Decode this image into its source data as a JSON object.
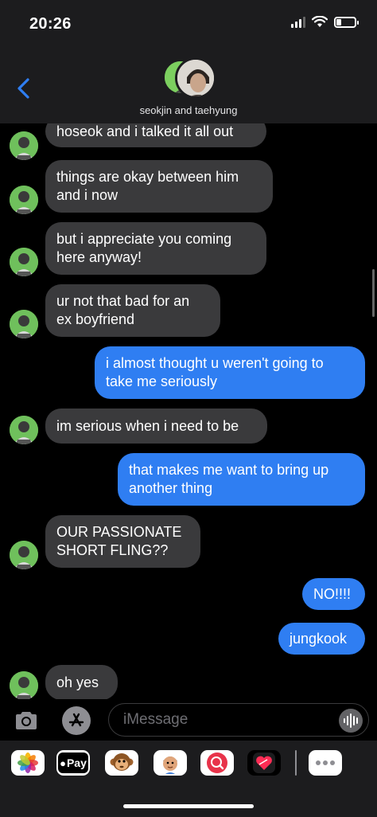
{
  "status": {
    "time": "20:26"
  },
  "header": {
    "group_name": "seokjin and taehyung"
  },
  "messages": [
    {
      "dir": "in",
      "lines": [
        "hoseok and i talked it all out"
      ]
    },
    {
      "dir": "in",
      "lines": [
        "things are okay between him",
        "and i now"
      ]
    },
    {
      "dir": "in",
      "lines": [
        "but i appreciate you coming",
        "here anyway!"
      ]
    },
    {
      "dir": "in",
      "lines": [
        "ur not that bad for an",
        "ex boyfriend"
      ]
    },
    {
      "dir": "out",
      "lines": [
        "i almost thought u weren't going to",
        "take me seriously"
      ]
    },
    {
      "dir": "in",
      "lines": [
        "im serious when i need to be"
      ]
    },
    {
      "dir": "out",
      "lines": [
        "that makes me want to bring up",
        "another thing"
      ]
    },
    {
      "dir": "in",
      "lines": [
        "OUR PASSIONATE",
        "SHORT FLING??"
      ]
    },
    {
      "dir": "out",
      "lines": [
        "NO!!!!"
      ]
    },
    {
      "dir": "out",
      "lines": [
        "jungkook"
      ]
    },
    {
      "dir": "in",
      "lines": [
        "oh yes"
      ]
    }
  ],
  "compose": {
    "placeholder": "iMessage"
  },
  "drawer": {
    "apps": [
      {
        "name": "photos-app-button",
        "icon": "photos-icon"
      },
      {
        "name": "apple-pay-button",
        "icon": "apple-pay-icon",
        "label": "Pay"
      },
      {
        "name": "animoji-button",
        "icon": "monkey-animoji-icon"
      },
      {
        "name": "memoji-button",
        "icon": "memoji-icon"
      },
      {
        "name": "image-search-button",
        "icon": "globe-search-icon"
      },
      {
        "name": "digital-touch-button",
        "icon": "heart-touch-icon"
      },
      {
        "name": "more-apps-button",
        "icon": "ellipsis-icon"
      }
    ]
  },
  "colors": {
    "incoming_bubble": "#3a3a3c",
    "outgoing_bubble": "#2f7ef2",
    "header_bg": "#1c1c1e",
    "accent": "#2f7ef2"
  }
}
